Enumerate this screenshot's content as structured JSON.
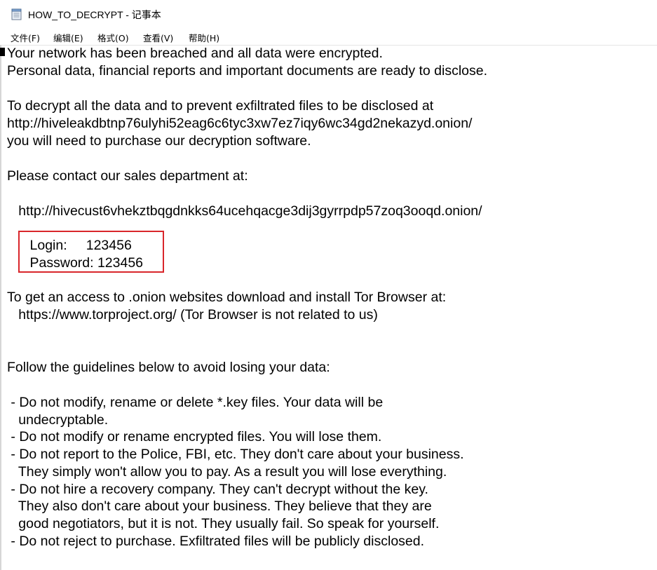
{
  "window": {
    "title": "HOW_TO_DECRYPT - 记事本",
    "icon": "notepad-icon"
  },
  "menu": {
    "items": [
      "文件(F)",
      "编辑(E)",
      "格式(O)",
      "查看(V)",
      "帮助(H)"
    ]
  },
  "document": {
    "lines": [
      "Your network has been breached and all data were encrypted.",
      "Personal data, financial reports and important documents are ready to disclose.",
      "",
      "To decrypt all the data and to prevent exfiltrated files to be disclosed at",
      "http://hiveleakdbtnp76ulyhi52eag6c6tyc3xw7ez7iqy6wc34gd2nekazyd.onion/",
      "you will need to purchase our decryption software.",
      "",
      "Please contact our sales department at:",
      "",
      "   http://hivecust6vhekztbqgdnkks64ucehqacge3dij3gyrrpdp57zoq3ooqd.onion/",
      "",
      "      Login:     123456",
      "      Password: 123456",
      "",
      "To get an access to .onion websites download and install Tor Browser at:",
      "   https://www.torproject.org/ (Tor Browser is not related to us)",
      "",
      "",
      "Follow the guidelines below to avoid losing your data:",
      "",
      " - Do not modify, rename or delete *.key files. Your data will be",
      "   undecryptable.",
      " - Do not modify or rename encrypted files. You will lose them.",
      " - Do not report to the Police, FBI, etc. They don't care about your business.",
      "   They simply won't allow you to pay. As a result you will lose everything.",
      " - Do not hire a recovery company. They can't decrypt without the key.",
      "   They also don't care about your business. They believe that they are",
      "   good negotiators, but it is not. They usually fail. So speak for yourself.",
      " - Do not reject to purchase. Exfiltrated files will be publicly disclosed."
    ]
  },
  "colors": {
    "highlight_border": "#d9262b",
    "text": "#000000",
    "background": "#ffffff"
  }
}
